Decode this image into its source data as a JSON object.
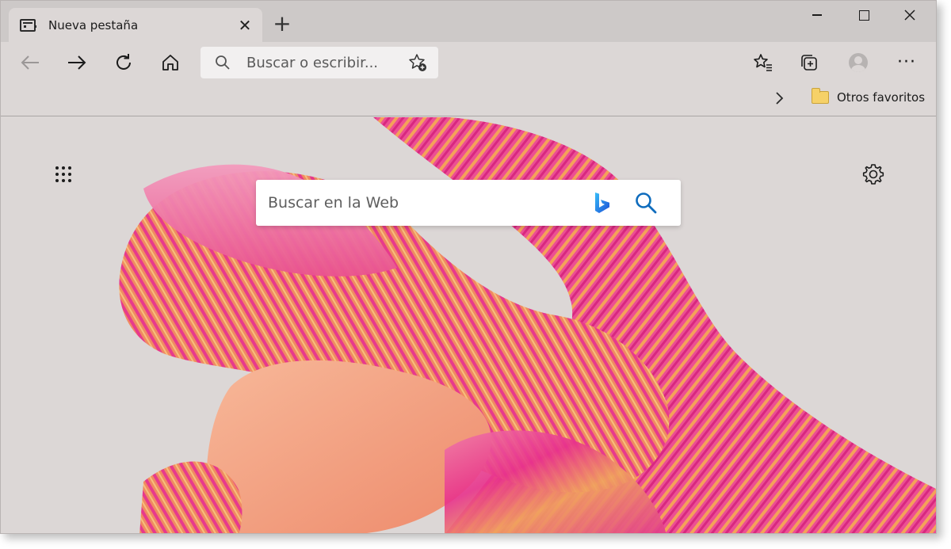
{
  "tab": {
    "title": "Nueva pestaña",
    "close_icon": "close-icon",
    "favicon": "newtab-page-icon"
  },
  "newtab_label": "+",
  "address_bar": {
    "placeholder": "Buscar o escribir..."
  },
  "favorites_bar": {
    "folder_label": "Otros favoritos"
  },
  "more_menu_label": "···",
  "search": {
    "placeholder": "Buscar en la Web"
  },
  "colors": {
    "chrome_bg": "#dcd7d6",
    "tabstrip_bg": "#cdc9c8",
    "search_icon_blue": "#0f6cbd",
    "art_magenta": "#e8328c",
    "art_orange": "#f2a07a",
    "art_gold": "#e0a45a"
  }
}
